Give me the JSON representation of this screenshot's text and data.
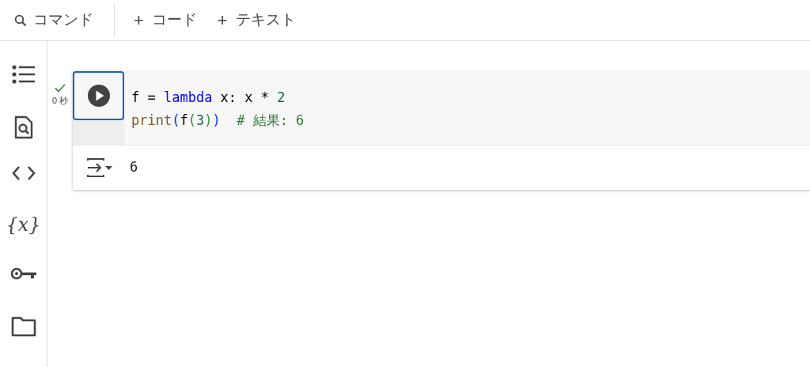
{
  "toolbar": {
    "search_label": "コマンド",
    "add_buttons": [
      {
        "sign": "+",
        "label": "コード"
      },
      {
        "sign": "+",
        "label": "テキスト"
      }
    ]
  },
  "sidebar": {
    "items": [
      {
        "kind": "list"
      },
      {
        "kind": "find"
      },
      {
        "kind": "code"
      },
      {
        "kind": "text",
        "glyph": "{x}"
      },
      {
        "kind": "key"
      },
      {
        "kind": "folder"
      }
    ]
  },
  "cell": {
    "status": {
      "done": true,
      "time": "0 秒"
    },
    "run_focused": true,
    "code_lines": [
      [
        {
          "kind": "plain",
          "text": "f = "
        },
        {
          "kind": "keyword",
          "text": "lambda"
        },
        {
          "kind": "plain",
          "text": " x: x * "
        },
        {
          "kind": "number",
          "text": "2"
        }
      ],
      [
        {
          "kind": "builtin",
          "text": "print"
        },
        {
          "kind": "paren1",
          "text": "("
        },
        {
          "kind": "plain",
          "text": "f"
        },
        {
          "kind": "paren2",
          "text": "("
        },
        {
          "kind": "number",
          "text": "3"
        },
        {
          "kind": "paren2",
          "text": ")"
        },
        {
          "kind": "paren1",
          "text": ")"
        },
        {
          "kind": "comment",
          "text": "# 結果: 6"
        }
      ]
    ],
    "output": "6"
  }
}
